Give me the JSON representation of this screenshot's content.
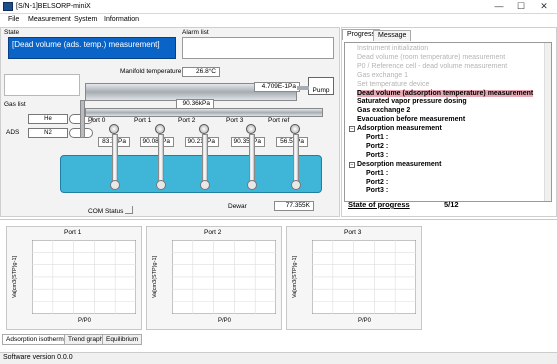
{
  "window": {
    "title": "[S/N-1]BELSORP-miniX",
    "minimize": "—",
    "maximize": "☐",
    "close": "✕"
  },
  "menu": [
    "File",
    "Measurement",
    "System",
    "Information"
  ],
  "left": {
    "state_label": "State",
    "state_value": "[Dead volume (ads. temp.) measurement]",
    "alarm_label": "Alarm list",
    "gas_list_label": "Gas list",
    "ads_label": "ADS",
    "gases": [
      "He",
      "N2"
    ],
    "manifold_label": "Manifold temperature",
    "manifold_temp": "26.8°C",
    "pump_pressure": "4.709E-1Pa",
    "pump_label": "Pump",
    "manifold_pressure": "90.36kPa",
    "ports": [
      {
        "name": "Port 0",
        "pressure": "83.3kPa"
      },
      {
        "name": "Port 1",
        "pressure": "90.08kPa"
      },
      {
        "name": "Port 2",
        "pressure": "90.21kPa"
      },
      {
        "name": "Port 3",
        "pressure": "90.35kPa"
      },
      {
        "name": "Port ref",
        "pressure": "56.5kPa"
      }
    ],
    "dewar_label": "Dewar",
    "dewar_temp": "77.355K",
    "com_status": "COM Status"
  },
  "right": {
    "tabs": [
      "Progress",
      "Message"
    ],
    "steps": [
      {
        "text": "Instrument initialization",
        "style": "grey"
      },
      {
        "text": "Dead volume (room temperature) measurement",
        "style": "grey"
      },
      {
        "text": "P0 / Reference cell - dead volume measurement",
        "style": "grey"
      },
      {
        "text": "Gas exchange 1",
        "style": "grey"
      },
      {
        "text": "Set temperature device",
        "style": "grey"
      },
      {
        "text": "Dead volume (adsorption temperature) measurement",
        "style": "hl"
      },
      {
        "text": "Saturated vapor pressure dosing",
        "style": "bold"
      },
      {
        "text": "Gas exchange 2",
        "style": "bold"
      },
      {
        "text": "Evacuation before measurement",
        "style": "bold"
      },
      {
        "text": "Adsorption measurement",
        "style": "bold"
      },
      {
        "text": "Port1 :",
        "style": "bold"
      },
      {
        "text": "Port2 :",
        "style": "bold"
      },
      {
        "text": "Port3 :",
        "style": "bold"
      },
      {
        "text": "Desorption measurement",
        "style": "bold"
      },
      {
        "text": "Port1 :",
        "style": "bold"
      },
      {
        "text": "Port2 :",
        "style": "bold"
      },
      {
        "text": "Port3 :",
        "style": "bold"
      }
    ],
    "state_of_progress_label": "State of progress",
    "progress_value": "5/12",
    "progress_fraction": 0.4167
  },
  "charts": [
    {
      "title": "Port 1",
      "ylabel": "Va[cm3(STP)g-1]",
      "xlabel": "P/P0"
    },
    {
      "title": "Port 2",
      "ylabel": "Va[cm3(STP)g-1]",
      "xlabel": "P/P0"
    },
    {
      "title": "Port 3",
      "ylabel": "Va[cm3(STP)g-1]",
      "xlabel": "P/P0"
    }
  ],
  "bottom_tabs": [
    "Adsorption isotherm",
    "Trend graph",
    "Equilibrium"
  ],
  "status": {
    "software_version": "Software version 0.0.0"
  }
}
